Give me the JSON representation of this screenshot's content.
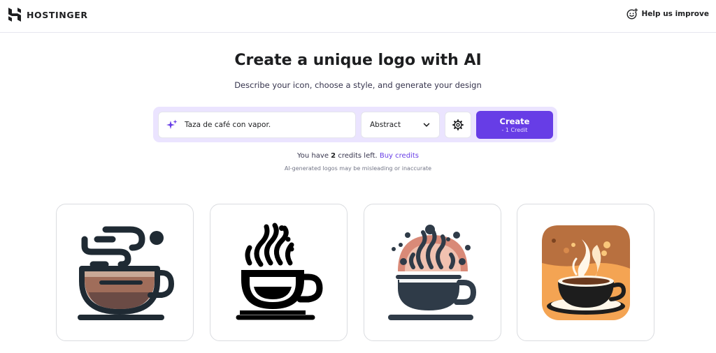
{
  "header": {
    "brand": "HOSTINGER",
    "help": "Help us improve"
  },
  "hero": {
    "title": "Create a unique logo with AI",
    "subtitle": "Describe your icon, choose a style, and generate your design"
  },
  "prompt": {
    "value": "Taza de café con vapor.",
    "style": "Abstract",
    "create_label": "Create",
    "create_sub": "- 1 Credit"
  },
  "credits": {
    "prefix": "You have ",
    "count": "2",
    "suffix": " credits left. ",
    "buy": "Buy credits",
    "disclaimer": "AI-generated logos may be misleading or inaccurate"
  },
  "results": [
    {
      "icon": "coffee-cup-flat-icon"
    },
    {
      "icon": "coffee-cup-black-icon"
    },
    {
      "icon": "coffee-cup-dotted-steam-icon"
    },
    {
      "icon": "coffee-cup-orange-app-icon"
    }
  ],
  "colors": {
    "accent": "#673de6",
    "prompt_bar_bg": "#ebe4ff",
    "text_dark": "#1d1e20"
  }
}
